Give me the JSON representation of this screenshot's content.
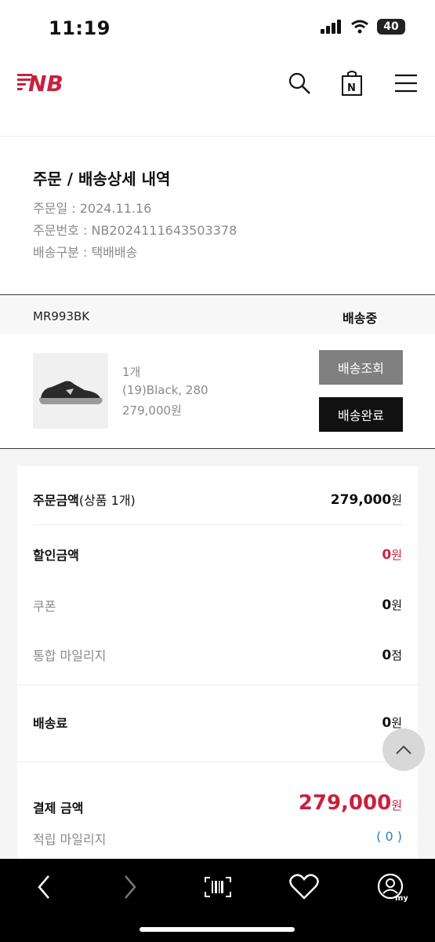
{
  "status_bar": {
    "time": "11:19",
    "battery": "40"
  },
  "header": {
    "logo_alt": "NB",
    "search_icon": "search-icon",
    "bag_icon": "shopping-bag-icon",
    "menu_icon": "hamburger-menu-icon"
  },
  "order": {
    "title": "주문 / 배송상세 내역",
    "date": "주문일 : 2024.11.16",
    "number": "주문번호 : NB2024111643503378",
    "shipping_type": "배송구분 : 택배배송"
  },
  "item": {
    "model": "MR993BK",
    "status": "배송중",
    "quantity": "1개",
    "option": "(19)Black, 280",
    "price": "279,000원",
    "track_button": "배송조회",
    "complete_button": "배송완료"
  },
  "payment": {
    "order_amount_label": "주문금액",
    "order_amount_sub": "(상품 1개)",
    "order_amount_value": "279,000",
    "discount_label": "할인금액",
    "discount_value": "0",
    "coupon_label": "쿠폰",
    "coupon_value": "0",
    "mileage_label": "통합 마일리지",
    "mileage_value": "0",
    "shipping_label": "배송료",
    "shipping_value": "0",
    "total_label": "결제 금액",
    "total_value": "279,000",
    "earn_label": "적립 마일리지",
    "earn_value": "( 0 )",
    "won": "원",
    "point": "점"
  },
  "colors": {
    "accent_red": "#c8213e",
    "link_blue": "#2a7fc0",
    "button_gray": "#808080"
  }
}
